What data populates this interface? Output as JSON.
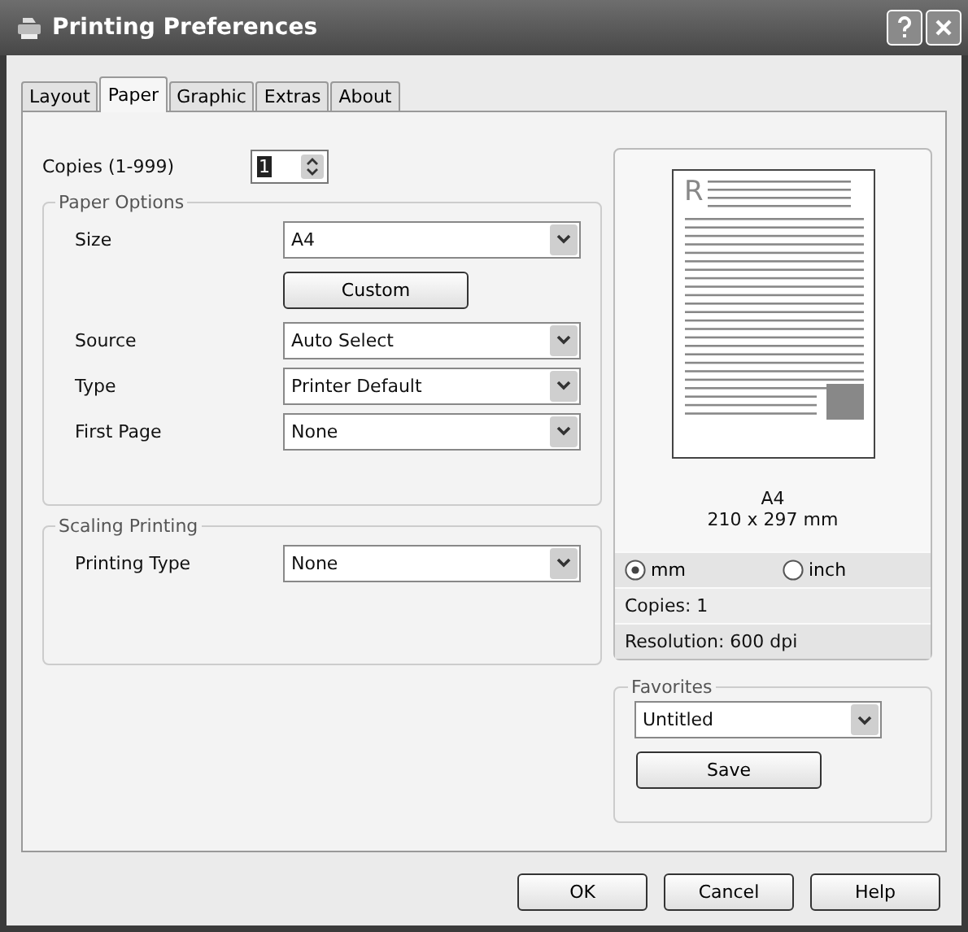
{
  "window": {
    "title": "Printing Preferences"
  },
  "tabs": [
    {
      "label": "Layout",
      "selected": false
    },
    {
      "label": "Paper",
      "selected": true
    },
    {
      "label": "Graphic",
      "selected": false
    },
    {
      "label": "Extras",
      "selected": false
    },
    {
      "label": "About",
      "selected": false
    }
  ],
  "copies": {
    "label": "Copies (1-999)",
    "value": "1"
  },
  "paper_options": {
    "title": "Paper Options",
    "fields": [
      {
        "kind": "select",
        "label": "Size",
        "value": "A4"
      },
      {
        "kind": "button",
        "label": "Custom"
      },
      {
        "kind": "select",
        "label": "Source",
        "value": "Auto Select"
      },
      {
        "kind": "select",
        "label": "Type",
        "value": "Printer Default"
      },
      {
        "kind": "select",
        "label": "First Page",
        "value": "None"
      }
    ]
  },
  "scaling_printing": {
    "title": "Scaling Printing",
    "fields": [
      {
        "kind": "select",
        "label": "Printing Type",
        "value": "None"
      }
    ]
  },
  "preview": {
    "letter": "R",
    "paper": "A4",
    "dimensions": "210 x 297 mm",
    "units": [
      {
        "label": "mm",
        "selected": true
      },
      {
        "label": "inch",
        "selected": false
      }
    ],
    "info": [
      "Copies: 1",
      "Resolution: 600 dpi"
    ]
  },
  "favorites": {
    "title": "Favorites",
    "value": "Untitled",
    "button": "Save"
  },
  "buttons": [
    "OK",
    "Cancel",
    "Help"
  ]
}
